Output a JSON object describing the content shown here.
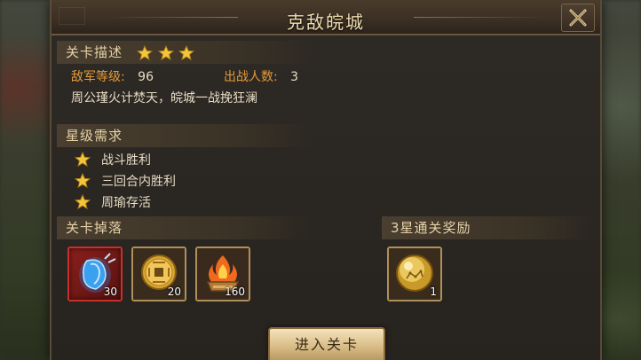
{
  "dialog": {
    "title": "克敌皖城",
    "close_icon": "close-icon"
  },
  "stage_desc": {
    "header": "关卡描述",
    "stars": 3,
    "enemy_level_label": "敌军等级:",
    "enemy_level_value": "96",
    "team_size_label": "出战人数:",
    "team_size_value": "3",
    "story": "周公瑾火计焚天，皖城一战挽狂澜"
  },
  "star_requirements": {
    "header": "星级需求",
    "items": [
      {
        "label": "战斗胜利"
      },
      {
        "label": "三回合内胜利"
      },
      {
        "label": "周瑜存活"
      }
    ]
  },
  "drops": {
    "header": "关卡掉落",
    "items": [
      {
        "icon": "blue-crystal-icon",
        "count": "30"
      },
      {
        "icon": "gold-coin-icon",
        "count": "20"
      },
      {
        "icon": "fire-brazier-icon",
        "count": "160"
      }
    ]
  },
  "reward": {
    "header": "3星通关奖励",
    "items": [
      {
        "icon": "gold-orb-icon",
        "count": "1"
      }
    ]
  },
  "enter_button": "进入关卡",
  "colors": {
    "accent_orange": "#e39a3a",
    "title_gold": "#f0dcae",
    "star_gold": "#f2c53a"
  }
}
